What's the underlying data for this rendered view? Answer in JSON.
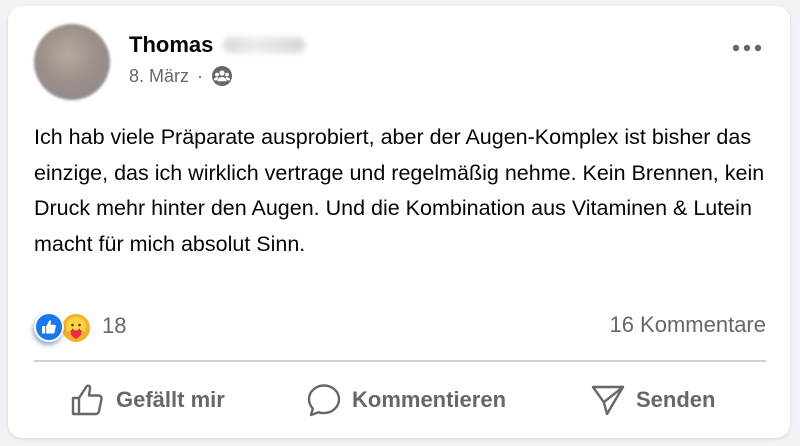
{
  "post": {
    "author_name": "Thomas",
    "date": "8. März",
    "separator": "·",
    "audience_icon": "friends-icon",
    "text": "Ich hab viele Präparate ausprobiert, aber der Augen-Komplex ist bisher das einzige, das ich wirklich vertrage und regelmäßig nehme. Kein Brennen, kein Druck mehr hinter den Augen. Und die Kombination aus Vitaminen & Lutein macht für mich absolut Sinn.",
    "reactions": {
      "icons": [
        "like-icon",
        "care-icon"
      ],
      "count": "18"
    },
    "comments_count": "16 Kommentare"
  },
  "actions": {
    "like_label": "Gefällt mir",
    "comment_label": "Kommentieren",
    "share_label": "Senden"
  },
  "colors": {
    "like_blue": "#1877f2",
    "muted_text": "#65676b",
    "care_yellow": "#f7b125"
  }
}
